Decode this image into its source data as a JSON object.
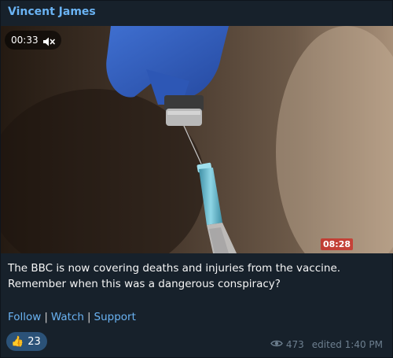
{
  "post": {
    "author": "Vincent James",
    "video": {
      "elapsed": "00:33",
      "overlay_time": "08:28",
      "muted": true
    },
    "message_line1": "The BBC is now covering deaths and injuries from the vaccine.",
    "message_line2": "Remember when this was a dangerous conspiracy?",
    "links": {
      "follow": "Follow",
      "watch": "Watch",
      "support": "Support",
      "separator": "|"
    },
    "reaction": {
      "emoji": "👍",
      "count": "23"
    },
    "views": "473",
    "edited": "edited 1:40 PM"
  },
  "colors": {
    "background": "#17212b",
    "accent_link": "#6ab3f3",
    "reaction_bg": "#2b5278",
    "meta_text": "#6d7f8f"
  },
  "icons": [
    "mute-icon",
    "eye-icon",
    "thumbs-up-icon"
  ]
}
